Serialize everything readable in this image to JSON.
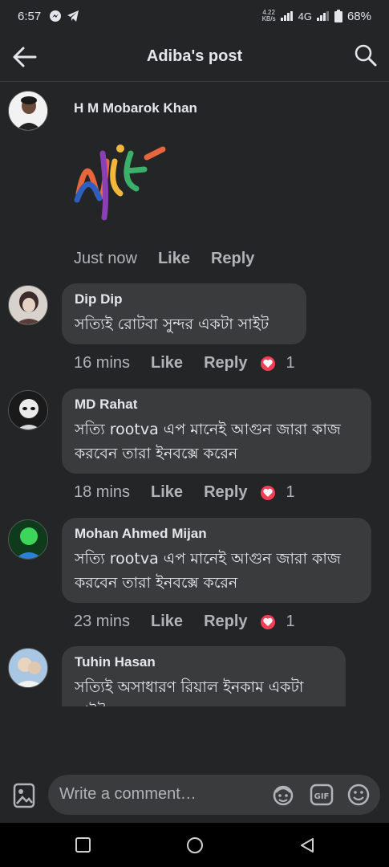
{
  "status": {
    "time": "6:57",
    "speed_top": "4.22",
    "speed_bottom": "KB/s",
    "network": "4G",
    "battery": "68%"
  },
  "header": {
    "title": "Adiba's post"
  },
  "comments": [
    {
      "author": "H M Mobarok Khan",
      "sticker": "NICE",
      "timestamp": "Just now",
      "like": "Like",
      "reply": "Reply"
    },
    {
      "author": "Dip Dip",
      "text": "সত্যিই রোটবা সুন্দর একটা সাইট",
      "timestamp": "16 mins",
      "like": "Like",
      "reply": "Reply",
      "reactions": "1"
    },
    {
      "author": "MD Rahat",
      "text": "সত্যি rootva এপ মানেই আগুন জারা কাজ করবেন তারা ইনবক্সে করেন",
      "timestamp": "18 mins",
      "like": "Like",
      "reply": "Reply",
      "reactions": "1"
    },
    {
      "author": "Mohan Ahmed Mijan",
      "text": "সত্যি rootva এপ মানেই আগুন জারা কাজ করবেন তারা ইনবক্সে করেন",
      "timestamp": "23 mins",
      "like": "Like",
      "reply": "Reply",
      "reactions": "1"
    },
    {
      "author": "Tuhin Hasan",
      "text": "সত্যিই অসাধারণ রিয়াল ইনকাম একটা সাইট"
    }
  ],
  "composer": {
    "placeholder": "Write a comment…"
  },
  "colors": {
    "background": "#242526",
    "bubble": "#3a3b3c",
    "text": "#e4e6eb",
    "muted": "#b0b3b8",
    "heart": "#f33e58"
  }
}
